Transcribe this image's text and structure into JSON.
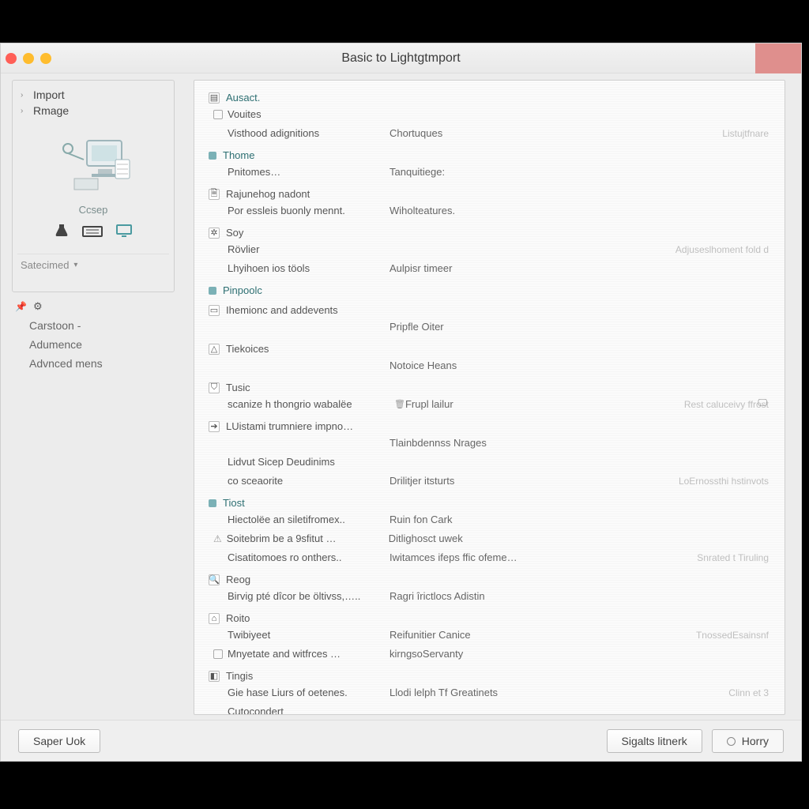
{
  "window": {
    "title": "Basic to Lightgtmport"
  },
  "sidebar": {
    "nav": [
      {
        "label": "Import"
      },
      {
        "label": "Rmage"
      }
    ],
    "illustration_caption": "Ccsep",
    "tools": [
      {
        "name": "lab-icon"
      },
      {
        "name": "keyboard-icon"
      },
      {
        "name": "monitor-icon"
      }
    ],
    "select_label": "Satecimed",
    "menu": [
      {
        "label": "Carstoon -",
        "indent": true
      },
      {
        "label": "Adumence",
        "indent": true
      },
      {
        "label": "Advnced mens",
        "indent": true
      }
    ]
  },
  "groups": [
    {
      "title": "Ausact.",
      "icon": "doc",
      "items": [
        {
          "l": "Vouites",
          "ck": true
        },
        {
          "l": "Visthood adignitions",
          "m": "Chortuques",
          "r": "Listujtfnare"
        }
      ]
    },
    {
      "title": "Thome",
      "icon": "dot",
      "items": [
        {
          "l": "Pnitomes…",
          "m": "Tanquitiege:"
        }
      ]
    },
    {
      "title": "Rajunehog nadont",
      "icon": "page",
      "gray": true,
      "items": [
        {
          "l": "Por essleis buonly mennt.",
          "m": "Wiholteatures."
        }
      ]
    },
    {
      "title": "Soy",
      "icon": "gear",
      "gray": true,
      "items": [
        {
          "l": "Rövlier",
          "r": "Adjuseslhoment fold d"
        },
        {
          "l": "Lhyihoen ios töols",
          "m": "Aulpisr timeer"
        }
      ]
    },
    {
      "title": "Pinpoolc",
      "icon": "dot",
      "items": []
    },
    {
      "title": "Ihemionc and addevents",
      "icon": "rect",
      "gray": true,
      "items": []
    },
    {
      "title": "",
      "inline": "Ihemionc and addevents",
      "items": [
        {
          "l": "",
          "m": "Pripfle Oiter"
        }
      ]
    },
    {
      "title": "Tiekoices",
      "icon": "warn",
      "gray": true,
      "items": [
        {
          "l": "",
          "m": "Notoice Heans"
        }
      ]
    },
    {
      "title": "Tusic",
      "icon": "shield",
      "gray": true,
      "items": [
        {
          "l": "scanize h thongrio wabalëe",
          "m": "Frupl lailur",
          "r": "Rest caluceivy ffrost",
          "tiny": true
        }
      ]
    },
    {
      "title": "LUistami trumniere impno…",
      "icon": "arrow",
      "gray": true,
      "items": [
        {
          "l": "",
          "m": "Tlainbdennss Nrages"
        },
        {
          "l": "Lidvut Sicep Deudinims",
          "tiny_right": true
        },
        {
          "l": "co sceaorite",
          "m": "Drilitjer itsturts",
          "r": "LoErnossthi hstinvots"
        }
      ]
    },
    {
      "title": "Tiost",
      "icon": "dot",
      "items": [
        {
          "l": "Hiectolëe an siletifromex..",
          "m": "Ruin fon Cark"
        },
        {
          "l": "Soitebrim be a 9sfitut …",
          "m": "Ditlighosct uwek",
          "warn": true
        },
        {
          "l": "Cisatitomoes ro onthers..",
          "m": "Iwitamces ifeps ffic ofeme…",
          "r": "Snrated t Tiruling"
        }
      ]
    },
    {
      "title": "Reog",
      "icon": "mag",
      "gray": true,
      "items": [
        {
          "l": "Birvig pté dîcor be öltivss,…..",
          "m": "Ragri îrictlocs Adistin"
        }
      ]
    },
    {
      "title": "Roito",
      "icon": "home",
      "gray": true,
      "items": [
        {
          "l": "Twibiyeet",
          "m": "Reifunitier Canice",
          "r": "TnossedEsainsnf"
        },
        {
          "l": "Mnyetate and witfrces …",
          "m": "kirngsoServanty",
          "ck": true
        }
      ]
    },
    {
      "title": "Tingis",
      "icon": "pin",
      "gray": true,
      "items": [
        {
          "l": "Gie hase Liurs of oetenes.",
          "m": "Llodi lelph Tf Greatinets",
          "r": "Clinn et 3"
        }
      ]
    },
    {
      "title": "",
      "items": [
        {
          "l": "Cutocondert"
        }
      ]
    }
  ],
  "footer": {
    "left_button": "Saper Uok",
    "right_primary": "Sigalts litnerk",
    "right_secondary": "Horry"
  }
}
